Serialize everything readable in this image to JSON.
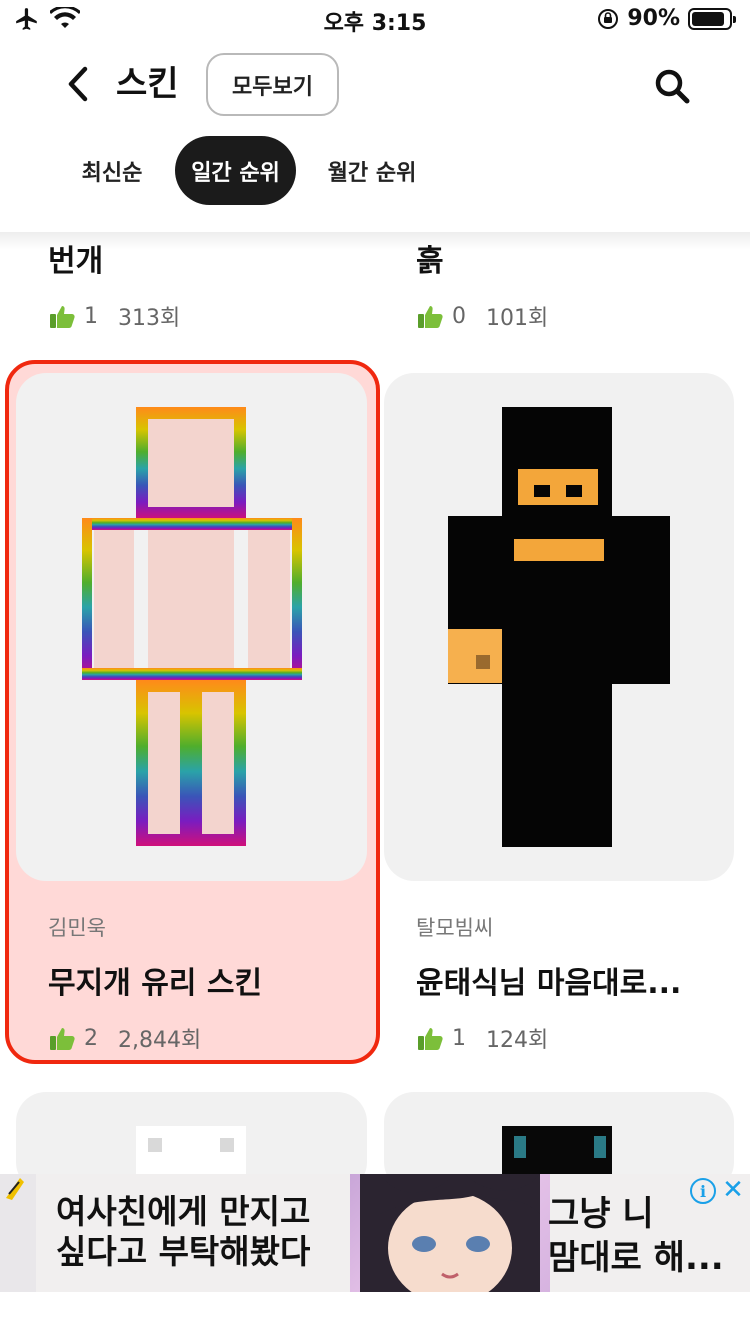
{
  "status_bar": {
    "time": "오후 3:15",
    "battery": "90%",
    "battery_level": 0.9
  },
  "header": {
    "title": "스킨",
    "view_all_label": "모두보기"
  },
  "tabs": [
    {
      "label": "최신순",
      "active": false
    },
    {
      "label": "일간 순위",
      "active": true
    },
    {
      "label": "월간 순위",
      "active": false
    }
  ],
  "top_cards": [
    {
      "title": "번개",
      "likes": "1",
      "views": "313회"
    },
    {
      "title": "흙",
      "likes": "0",
      "views": "101회"
    }
  ],
  "cards": [
    {
      "author": "김민욱",
      "title": "무지개 유리 스킨",
      "likes": "2",
      "views": "2,844회",
      "selected": true
    },
    {
      "author": "탈모빔씨",
      "title": "윤태식님  마음대로...",
      "likes": "1",
      "views": "124회",
      "selected": false
    }
  ],
  "ad": {
    "left_line1": "여사친에게 만지고",
    "left_line2": "싶다고 부탁해봤다",
    "right_line1": "그냥 니",
    "right_line2": "맘대로 해..."
  },
  "colors": {
    "accent_selected": "#f0280f",
    "tab_active_bg": "#1b1b1b",
    "like_icon": "#7cbf3a"
  }
}
